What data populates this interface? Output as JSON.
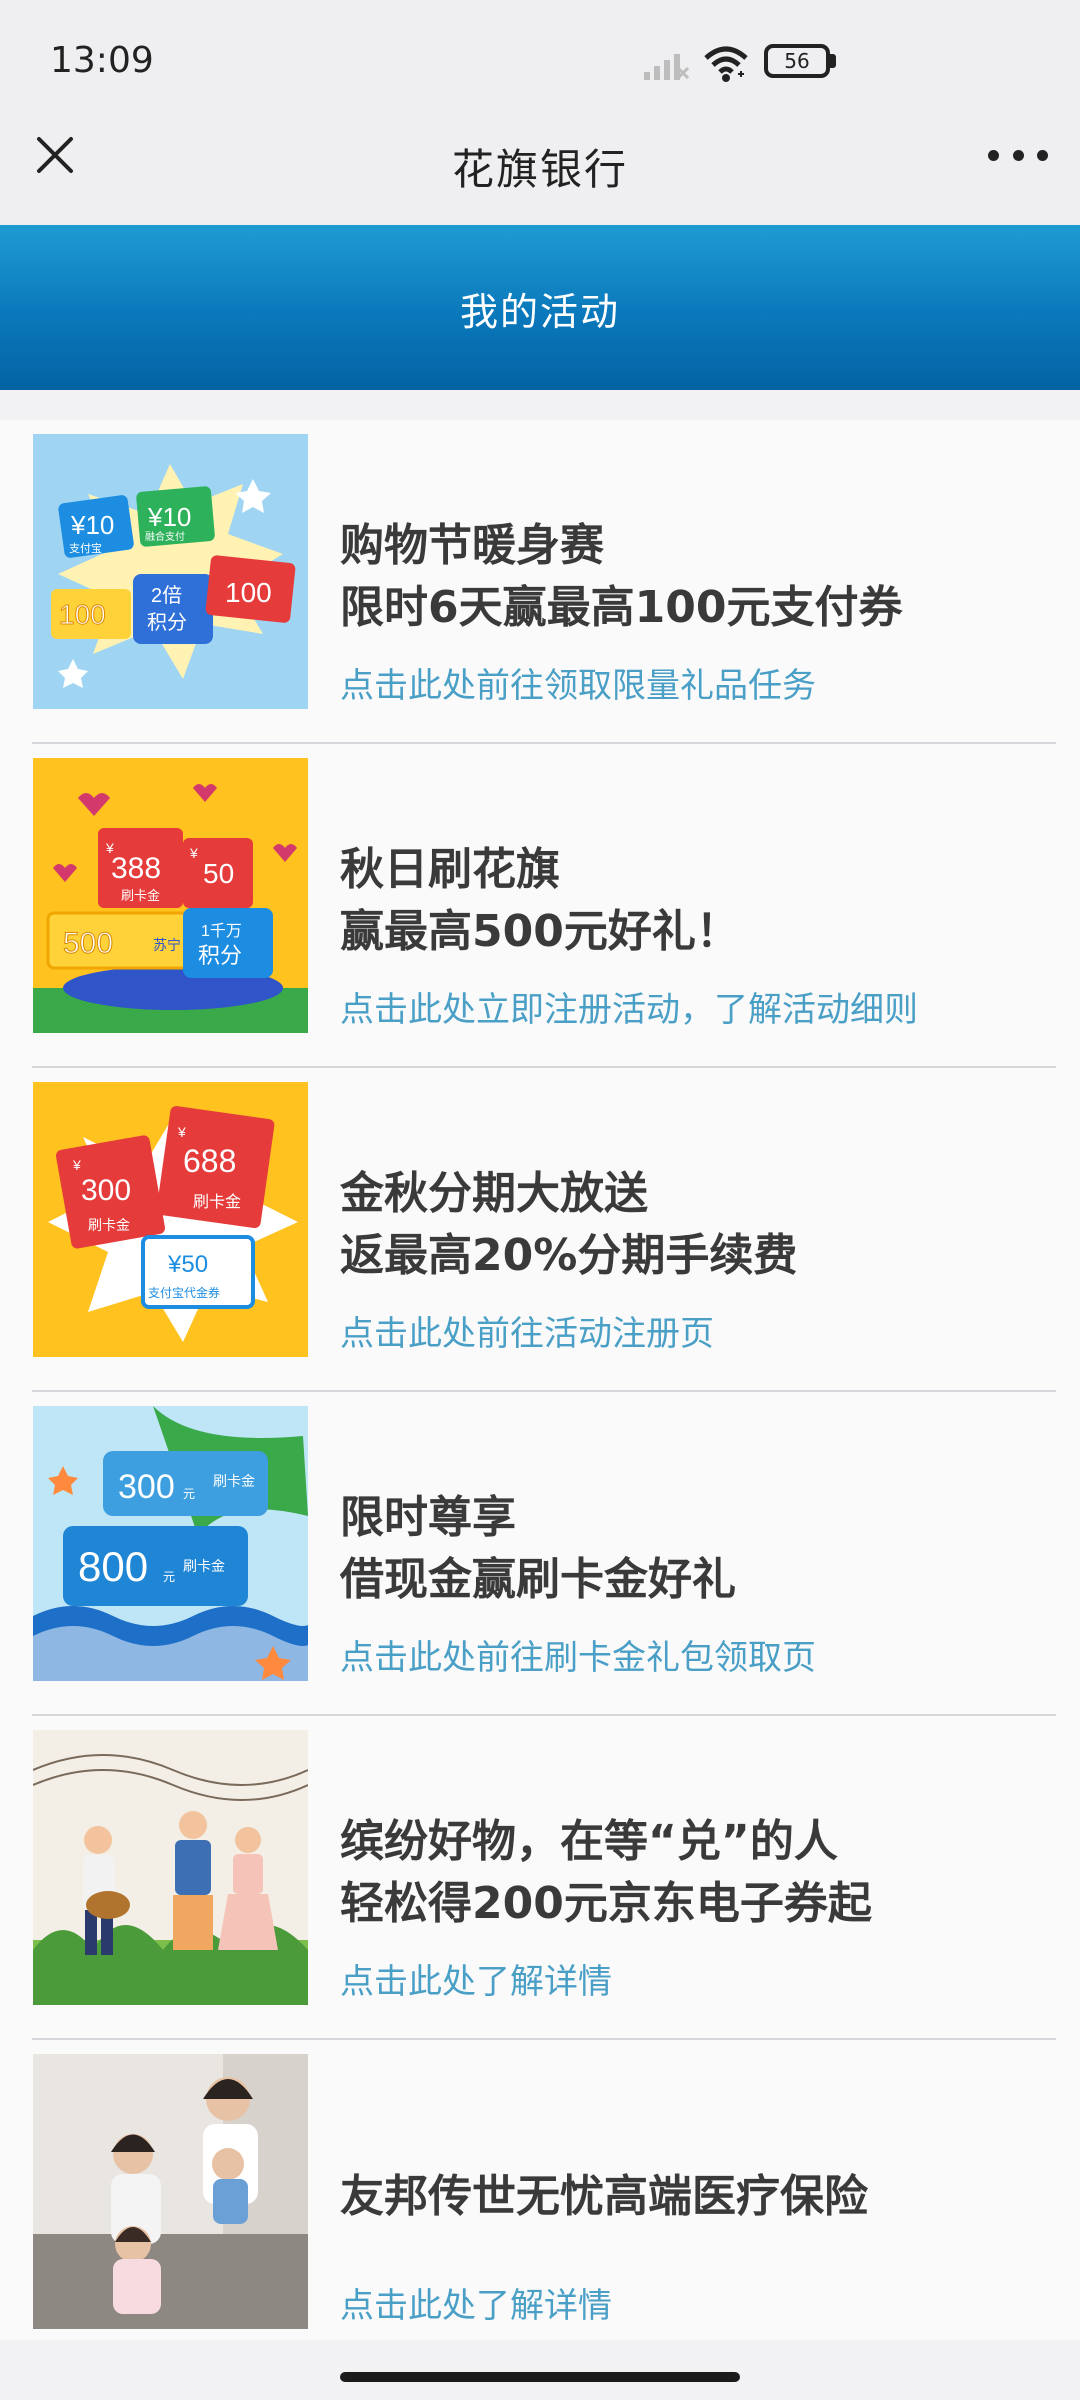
{
  "status_bar": {
    "time": "13:09",
    "battery": "56",
    "icons": [
      "signal-icon",
      "wifi-icon",
      "battery-icon"
    ]
  },
  "nav": {
    "title": "花旗银行",
    "close_icon": "close-icon",
    "more_icon": "more-icon"
  },
  "banner": {
    "title": "我的活动",
    "colors": {
      "top": "#1f9bd3",
      "bottom": "#0463a3"
    }
  },
  "activities": [
    {
      "title_line1": "购物节暖身赛",
      "title_line2": "限时6天赢最高100元支付券",
      "link": "点击此处前往领取限量礼品任务",
      "thumb": {
        "tags": [
          "¥10",
          "支付宝",
          "¥10",
          "融合支付",
          "100",
          "2倍",
          "积分",
          "100"
        ]
      }
    },
    {
      "title_line1": "秋日刷花旗",
      "title_line2": "赢最高500元好礼！",
      "link": "点击此处立即注册活动，了解活动细则",
      "thumb": {
        "tags": [
          "¥",
          "388",
          "刷卡金",
          "¥",
          "50",
          "500",
          "苏宁",
          "1千万",
          "积分"
        ]
      }
    },
    {
      "title_line1": "金秋分期大放送",
      "title_line2": "返最高20%分期手续费",
      "link": "点击此处前往活动注册页",
      "thumb": {
        "tags": [
          "¥",
          "300",
          "刷卡金",
          "¥",
          "688",
          "刷卡金",
          "¥50",
          "支付宝代金券"
        ]
      }
    },
    {
      "title_line1": "限时尊享",
      "title_line2": "借现金赢刷卡金好礼",
      "link": "点击此处前往刷卡金礼包领取页",
      "thumb": {
        "tags": [
          "300",
          "元",
          "刷卡金",
          "800",
          "元",
          "刷卡金"
        ]
      }
    },
    {
      "title_line1": "缤纷好物，在等“兑”的人",
      "title_line2": "轻松得200元京东电子券起",
      "link": "点击此处了解详情",
      "thumb": {
        "tags": []
      }
    },
    {
      "title_line1": "友邦传世无忧高端医疗保险",
      "title_line2": "",
      "link": "点击此处了解详情",
      "thumb": {
        "tags": []
      }
    }
  ],
  "colors": {
    "link": "#4a9fc6",
    "accent": "#0a78bb"
  }
}
